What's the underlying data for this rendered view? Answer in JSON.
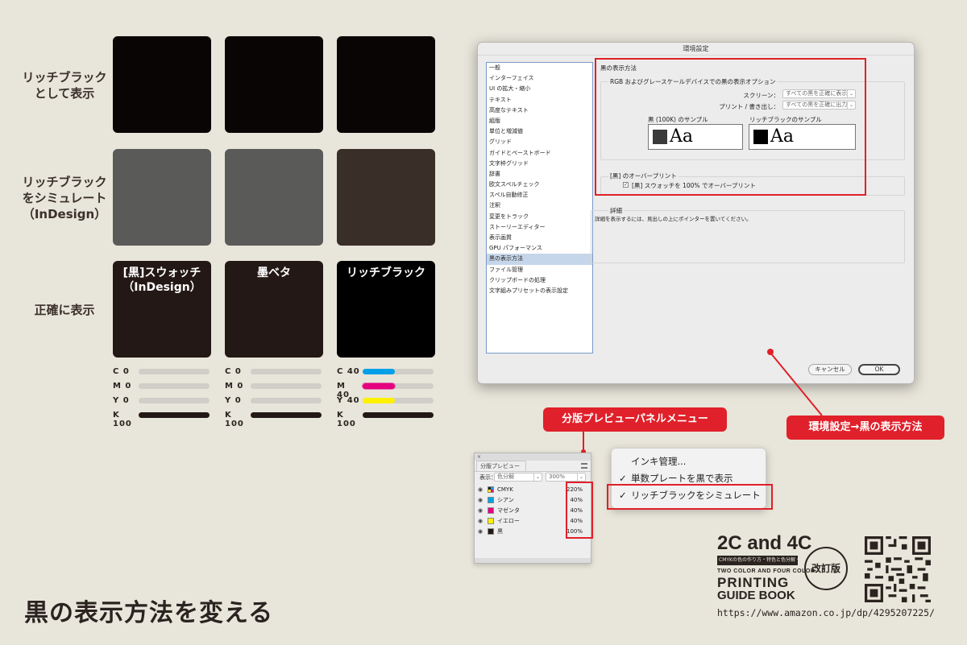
{
  "row_labels": {
    "rich": "リッチブラック\nとして表示",
    "simulate": "リッチブラック\nをシミュレート\n（InDesign）",
    "accurate": "正確に表示"
  },
  "swatch_titles": {
    "black_swatch": "[黒]スウォッチ\n（InDesign）",
    "sumi_beta": "墨ベタ",
    "rich_black": "リッチブラック"
  },
  "ink_bars": [
    {
      "id": "swatch",
      "rows": [
        {
          "label": "C  0",
          "value": 0,
          "color": "#d0cec9"
        },
        {
          "label": "M  0",
          "value": 0,
          "color": "#d0cec9"
        },
        {
          "label": "Y  0",
          "value": 0,
          "color": "#d0cec9"
        },
        {
          "label": "K 100",
          "value": 100,
          "color": "#231815"
        }
      ]
    },
    {
      "id": "sumi",
      "rows": [
        {
          "label": "C  0",
          "value": 0,
          "color": "#d0cec9"
        },
        {
          "label": "M  0",
          "value": 0,
          "color": "#d0cec9"
        },
        {
          "label": "Y  0",
          "value": 0,
          "color": "#d0cec9"
        },
        {
          "label": "K 100",
          "value": 100,
          "color": "#231815"
        }
      ]
    },
    {
      "id": "rich",
      "rows": [
        {
          "label": "C 40",
          "value": 40,
          "color": "#00a0e9"
        },
        {
          "label": "M 40",
          "value": 40,
          "color": "#e4007f"
        },
        {
          "label": "Y 40",
          "value": 40,
          "color": "#fff100"
        },
        {
          "label": "K 100",
          "value": 100,
          "color": "#231815"
        }
      ]
    }
  ],
  "dialog": {
    "title": "環境設定",
    "pref_items": [
      "一般",
      "インターフェイス",
      "UI の拡大・縮小",
      "テキスト",
      "高度なテキスト",
      "組版",
      "単位と増減値",
      "グリッド",
      "ガイドとペーストボード",
      "文字枠グリッド",
      "辞書",
      "欧文スペルチェック",
      "スペル自動修正",
      "注釈",
      "変更をトラック",
      "ストーリーエディター",
      "表示画質",
      "GPU パフォーマンス",
      "黒の表示方法",
      "ファイル管理",
      "クリップボードの処理",
      "文字組みプリセットの表示設定"
    ],
    "active_index": 18,
    "section_title": "黒の表示方法",
    "rgb_group": "RGB およびグレースケールデバイスでの黒の表示オプション",
    "screen_label": "スクリーン：",
    "screen_value": "すべての黒を正確に表示",
    "print_label": "プリント / 書き出し：",
    "print_value": "すべての黒を正確に出力",
    "sample_100k_label": "黒 (100K) のサンプル",
    "sample_rich_label": "リッチブラックのサンプル",
    "sample_text": "Aa",
    "overprint_group": "[黒] のオーバープリント",
    "overprint_check": "[黒] スウォッチを 100% でオーバープリント",
    "detail_group": "詳細",
    "detail_text": "詳細を表示するには、見出しの上にポインターを置いてください。",
    "cancel": "キャンセル",
    "ok": "OK"
  },
  "badges": {
    "panel_menu": "分版プレビューパネルメニュー",
    "prefs": "環境設定→黒の表示方法"
  },
  "panel": {
    "close": "×",
    "tab": "分版プレビュー",
    "view_label": "表示：",
    "view_value": "色分解",
    "zoom": "300%",
    "rows": [
      {
        "name": "CMYK",
        "pct": "220%",
        "color": "cmyk"
      },
      {
        "name": "シアン",
        "pct": "40%",
        "color": "#00a0e9"
      },
      {
        "name": "マゼンタ",
        "pct": "40%",
        "color": "#e4007f"
      },
      {
        "name": "イエロー",
        "pct": "40%",
        "color": "#fff100"
      },
      {
        "name": "黒",
        "pct": "100%",
        "color": "#231815"
      }
    ]
  },
  "menu": {
    "items": [
      {
        "label": "インキ管理...",
        "checked": false
      },
      {
        "label": "単数プレートを黒で表示",
        "checked": true
      },
      {
        "label": "リッチブラックをシミュレート",
        "checked": true
      }
    ]
  },
  "main_title": "黒の表示方法を変える",
  "book": {
    "title_line": "2C and 4C",
    "sub_jp": "CMYKの色の作り方・特色と色分解・トンボ・出力の基本 入稿データのつくりかた",
    "en_small": "TWO COLOR AND FOUR COLOR",
    "en_line1": "PRINTING",
    "en_line2": "GUIDE BOOK",
    "seal": "改訂版",
    "url": "https://www.amazon.co.jp/dp/4295207225/"
  },
  "colors": {
    "rich_display": "#0a0505",
    "simulate_swatch": "#5a5b58",
    "simulate_rich": "#3a2e28",
    "accurate_swatch": "#231815",
    "accurate_rich": "#000000",
    "accent_red": "#e0202a"
  }
}
